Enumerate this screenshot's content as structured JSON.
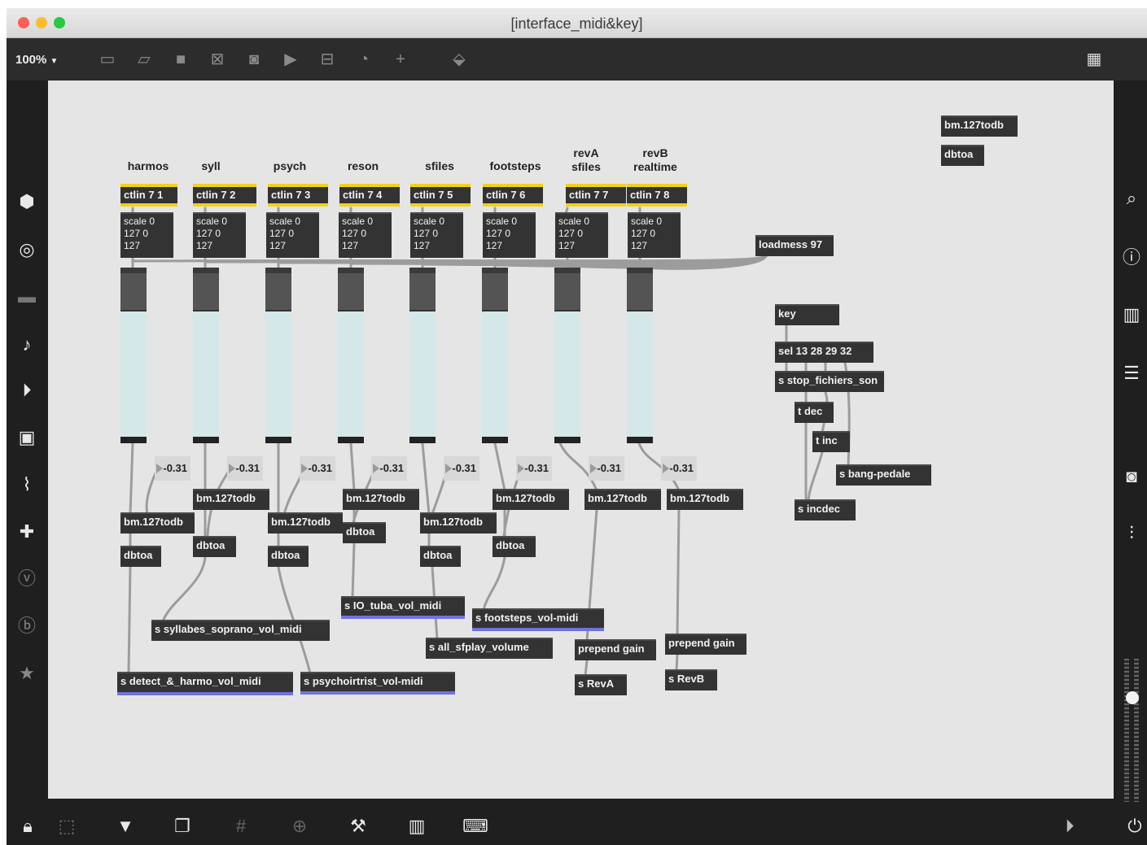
{
  "window": {
    "title": "[interface_midi&key]"
  },
  "toolbar": {
    "zoom": "100%",
    "zoom_caret": "▼"
  },
  "channels": [
    {
      "label": "harmos",
      "ctlin": "ctlin 7 1",
      "scale": "scale 0\n127 0\n127",
      "number": "-0.31",
      "todb": "bm.127todb",
      "dbtoa": "dbtoa"
    },
    {
      "label": "syll",
      "ctlin": "ctlin 7 2",
      "scale": "scale 0\n127 0\n127",
      "number": "-0.31",
      "todb": "bm.127todb",
      "dbtoa": "dbtoa"
    },
    {
      "label": "psych",
      "ctlin": "ctlin 7 3",
      "scale": "scale 0\n127 0\n127",
      "number": "-0.31",
      "todb": "bm.127todb",
      "dbtoa": "dbtoa"
    },
    {
      "label": "reson",
      "ctlin": "ctlin 7 4",
      "scale": "scale 0\n127 0\n127",
      "number": "-0.31",
      "todb": "bm.127todb",
      "dbtoa": "dbtoa"
    },
    {
      "label": "sfiles",
      "ctlin": "ctlin 7 5",
      "scale": "scale 0\n127 0\n127",
      "number": "-0.31",
      "todb": "bm.127todb",
      "dbtoa": "dbtoa"
    },
    {
      "label": "footsteps",
      "ctlin": "ctlin 7 6",
      "scale": "scale 0\n127 0\n127",
      "number": "-0.31",
      "todb": "bm.127todb",
      "dbtoa": "dbtoa"
    },
    {
      "label": "revA\nsfiles",
      "ctlin": "ctlin 7 7",
      "scale": "scale 0\n127 0\n127",
      "number": "-0.31",
      "todb": "bm.127todb",
      "prepend": "prepend gain",
      "send": "s RevA"
    },
    {
      "label": "revB\nrealtime",
      "ctlin": "ctlin 7 8",
      "scale": "scale 0\n127 0\n127",
      "number": "-0.31",
      "todb": "bm.127todb",
      "prepend": "prepend gain",
      "send": "s RevB"
    }
  ],
  "sends": {
    "harmo": "s detect_&_harmo_vol_midi",
    "syll": "s syllabes_soprano_vol_midi",
    "psych": "s psychoirtrist_vol-midi",
    "tuba": "s IO_tuba_vol_midi",
    "sfplay": "s all_sfplay_volume",
    "footsteps": "s footsteps_vol-midi"
  },
  "misc": {
    "loadmess": "loadmess 97",
    "key": "key",
    "sel": "sel 13 28 29 32",
    "stop": "s stop_fichiers_son",
    "tdec": "t dec",
    "tinc": "t inc",
    "bang": "s bang-pedale",
    "incdec": "s incdec",
    "corner_todb": "bm.127todb",
    "corner_dbtoa": "dbtoa"
  },
  "colors": {
    "canvas": "#e5e5e5",
    "object": "#333333",
    "ctlin_accent": "#f0d21a",
    "send_accent": "#7272e0",
    "slider_fill": "#d4e8ea"
  }
}
